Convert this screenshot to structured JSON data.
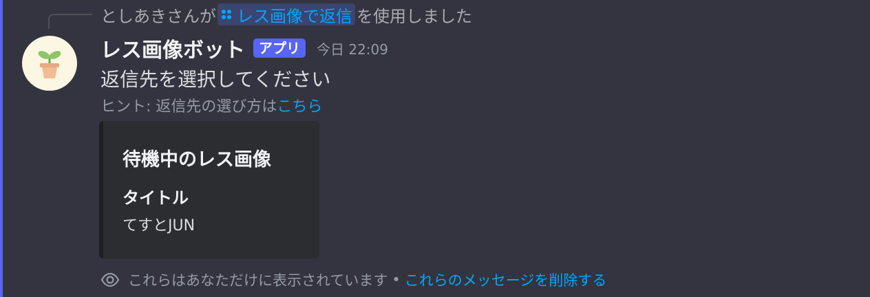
{
  "colors": {
    "background": "#33343f",
    "accent_bar": "#5865f2",
    "link": "#00a8fc",
    "app_badge": "#5865f2",
    "embed_bg": "#2b2d31"
  },
  "reply": {
    "user_prefix": "としあきさんが",
    "command_icon": "slash-command-icon",
    "command_name": "レス画像で返信",
    "suffix": "を使用しました"
  },
  "message": {
    "avatar_icon": "plant-pot-icon",
    "author": "レス画像ボット",
    "badge": "アプリ",
    "timestamp": "今日 22:09",
    "text": "返信先を選択してください",
    "hint_prefix": "ヒント: 返信先の選び方は",
    "hint_link": "こちら"
  },
  "embed": {
    "title": "待機中のレス画像",
    "field_name": "タイトル",
    "field_value": "てすとJUN"
  },
  "ephemeral": {
    "icon": "eye-icon",
    "notice": "これらはあなただけに表示されています",
    "separator": "•",
    "delete_link": "これらのメッセージを削除する"
  }
}
